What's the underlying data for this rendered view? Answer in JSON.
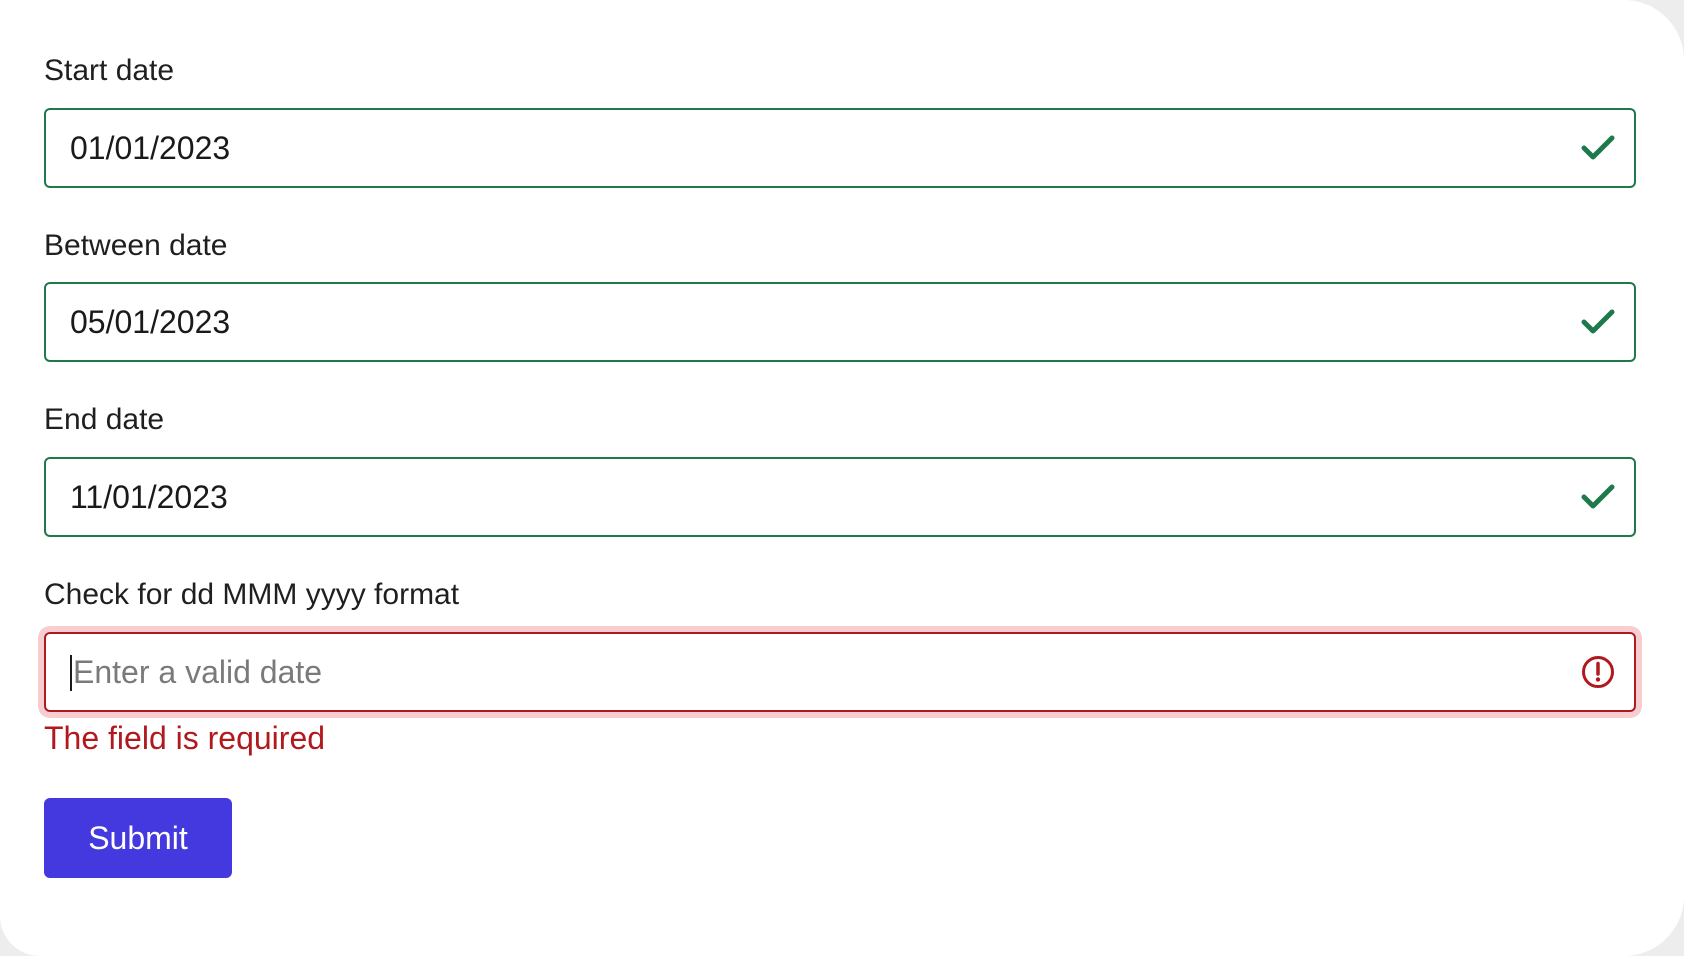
{
  "form": {
    "fields": [
      {
        "label": "Start date",
        "value": "01/01/2023",
        "state": "valid",
        "icon": "check-icon"
      },
      {
        "label": "Between date",
        "value": "05/01/2023",
        "state": "valid",
        "icon": "check-icon"
      },
      {
        "label": "End date",
        "value": "11/01/2023",
        "state": "valid",
        "icon": "check-icon"
      },
      {
        "label": "Check for dd MMM yyyy format",
        "value": "",
        "placeholder": "Enter a valid date",
        "state": "invalid",
        "icon": "error-icon",
        "error": "The field is required"
      }
    ],
    "submit_label": "Submit"
  },
  "colors": {
    "valid": "#1e7a4a",
    "invalid": "#b0191e",
    "invalid_ring": "#f6cdd0",
    "primary": "#4438df"
  }
}
